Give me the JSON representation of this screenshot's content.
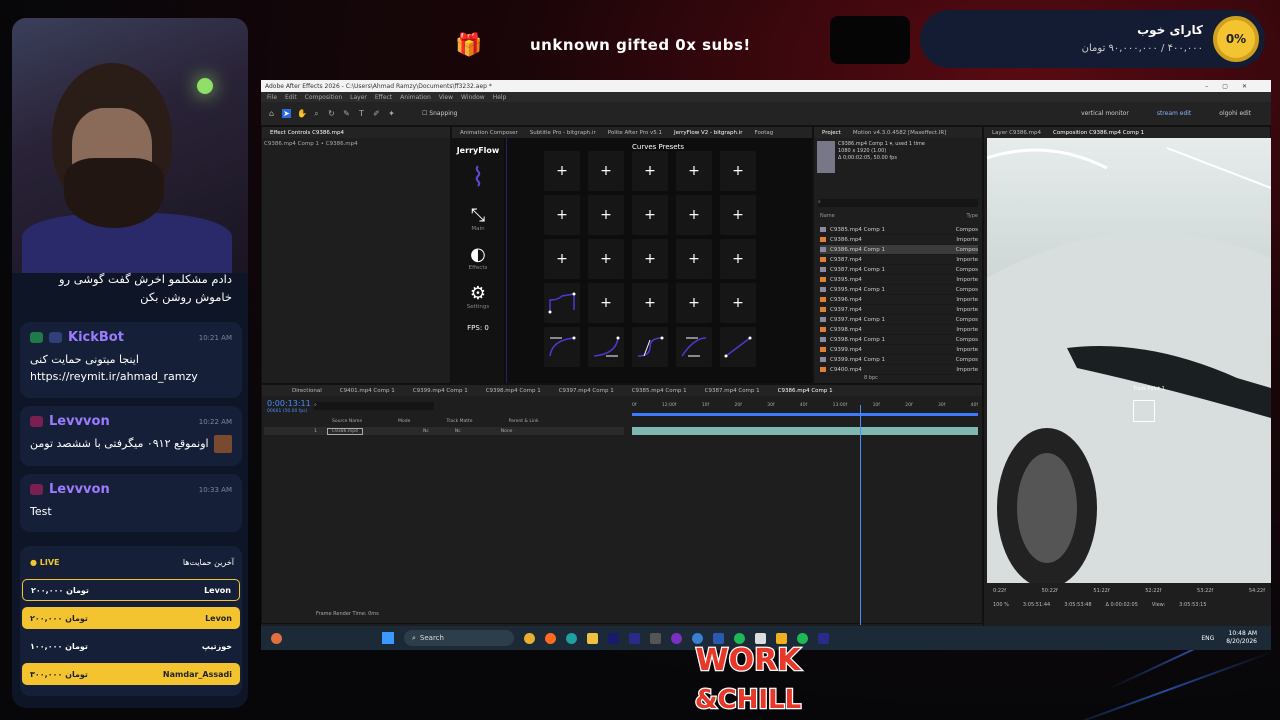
{
  "chat": {
    "first_message": "دادم مشکلمو اخرش گفت گوشی رو خاموش روشن بکن",
    "messages": [
      {
        "user": "KickBot",
        "time": "10:21 AM",
        "text_rtl": "اینجا میتونی حمایت کنی",
        "text_ltr": "https://reymit.ir/ahmad_ramzy"
      },
      {
        "user": "Levvvon",
        "time": "10:22 AM",
        "text_rtl": "اونموقع ۰۹۱۲ میگرفتی با ششصد تومن",
        "text_ltr": ""
      },
      {
        "user": "Levvvon",
        "time": "10:33 AM",
        "text_rtl": "",
        "text_ltr": "Test"
      }
    ]
  },
  "donations": {
    "live": "LIVE",
    "title": "آخرین حمایت‌ها",
    "items": [
      {
        "amount": "۲۰۰,۰۰۰ تومان",
        "name": "Levon",
        "style": "outline"
      },
      {
        "amount": "۲۰۰,۰۰۰ تومان",
        "name": "Levon",
        "style": "yellow"
      },
      {
        "amount": "۱۰۰,۰۰۰ تومان",
        "name": "خوزتیپ",
        "style": "dark"
      },
      {
        "amount": "۳۰۰,۰۰۰ تومان",
        "name": "Namdar_Assadi",
        "style": "yellow"
      }
    ]
  },
  "alert": {
    "text": "unknown gifted 0x subs!"
  },
  "goal": {
    "title": "کارای خوب",
    "amount": "۴۰۰,۰۰۰ / ۹۰,۰۰۰,۰۰۰ تومان",
    "percent": "0%"
  },
  "ae": {
    "title": "Adobe After Effects 2026 - C:\\Users\\Ahmad Ramzy\\Documents\\ff3232.aep *",
    "menu": [
      "File",
      "Edit",
      "Composition",
      "Layer",
      "Effect",
      "Animation",
      "View",
      "Window",
      "Help"
    ],
    "snapping": "Snapping",
    "workspaces": [
      "vertical monitor",
      "stream edit",
      "olgohi edit"
    ],
    "effect_tab": "Effect Controls C9386.mp4",
    "effect_sub": "C9386.mp4 Comp 1 • C9386.mp4",
    "plugin_tabs": [
      "Animation Composer",
      "Subtitle Pro - bitgraph.ir",
      "Polite After Pro v5.1",
      "JerryFlow V2 - bitgraph.ir",
      "Footag"
    ],
    "jerryflow": {
      "logo": "JerryFlow",
      "curves_title": "Curves Presets",
      "nav": [
        "Main",
        "Effects",
        "Settings"
      ],
      "fps": "FPS: 0"
    },
    "project_tabs": [
      "Project",
      "Motion v4.3.0.4582 [Maxeffect.IR]"
    ],
    "project_info": [
      "C9386.mp4 Comp 1 ▾, used 1 time",
      "1080 x 1920 (1.00)",
      "Δ 0;00:02:05, 50.00 fps"
    ],
    "project_cols": [
      "Name",
      "Type"
    ],
    "project_items": [
      {
        "name": "C9385.mp4 Comp 1",
        "type": "Compos"
      },
      {
        "name": "C9386.mp4",
        "type": "Importe"
      },
      {
        "name": "C9386.mp4 Comp 1",
        "type": "Compos",
        "sel": true
      },
      {
        "name": "C9387.mp4",
        "type": "Importe"
      },
      {
        "name": "C9387.mp4 Comp 1",
        "type": "Compos"
      },
      {
        "name": "C9395.mp4",
        "type": "Importe"
      },
      {
        "name": "C9395.mp4 Comp 1",
        "type": "Compos"
      },
      {
        "name": "C9396.mp4",
        "type": "Importe"
      },
      {
        "name": "C9397.mp4",
        "type": "Importe"
      },
      {
        "name": "C9397.mp4 Comp 1",
        "type": "Compos"
      },
      {
        "name": "C9398.mp4",
        "type": "Importe"
      },
      {
        "name": "C9398.mp4 Comp 1",
        "type": "Compos"
      },
      {
        "name": "C9399.mp4",
        "type": "Importe"
      },
      {
        "name": "C9399.mp4 Comp 1",
        "type": "Compos"
      },
      {
        "name": "C9400.mp4",
        "type": "Importe"
      }
    ],
    "bpc": "8 bpc",
    "viewer_tabs": [
      "Layer C9386.mp4",
      "Composition C9386.mp4 Comp 1"
    ],
    "track_point": "Track Point 1",
    "timeline_tabs": [
      "Directional",
      "C9401.mp4 Comp 1",
      "C9399.mp4 Comp 1",
      "C9398.mp4 Comp 1",
      "C9397.mp4 Comp 1",
      "C9385.mp4 Comp 1",
      "C9387.mp4 Comp 1",
      "C9386.mp4 Comp 1"
    ],
    "timecode": "0:00:13:11",
    "frames": "00661 (50.00 fps)",
    "layer_cols": [
      "Source Name",
      "Mode",
      "Track Matte",
      "Parent & Link"
    ],
    "layer": {
      "num": "1",
      "name": "C9386.mp4",
      "mode": "Nc",
      "matte": "Nc",
      "parent": "None"
    },
    "ruler": [
      "0f",
      "12:00f",
      "10f",
      "20f",
      "30f",
      "40f",
      "13:00f",
      "10f",
      "20f",
      "30f",
      "40f"
    ],
    "render_time": "Frame Render Time: 0ms",
    "viewer_ruler": [
      "0:22f",
      "50:22f",
      "51:22f",
      "52:22f",
      "53:22f",
      "54:22f"
    ],
    "viewer_status": [
      "100 %",
      "3:05:51:44",
      "3:05:53:48",
      "Δ 0:00:02:05",
      "View:",
      "3:05:53:15"
    ]
  },
  "taskbar": {
    "search": "Search",
    "lang": "ENG",
    "time": "10:48 AM",
    "date": "8/20/2026"
  },
  "logo": {
    "line1": "WORK",
    "line2": "& CHILL"
  }
}
